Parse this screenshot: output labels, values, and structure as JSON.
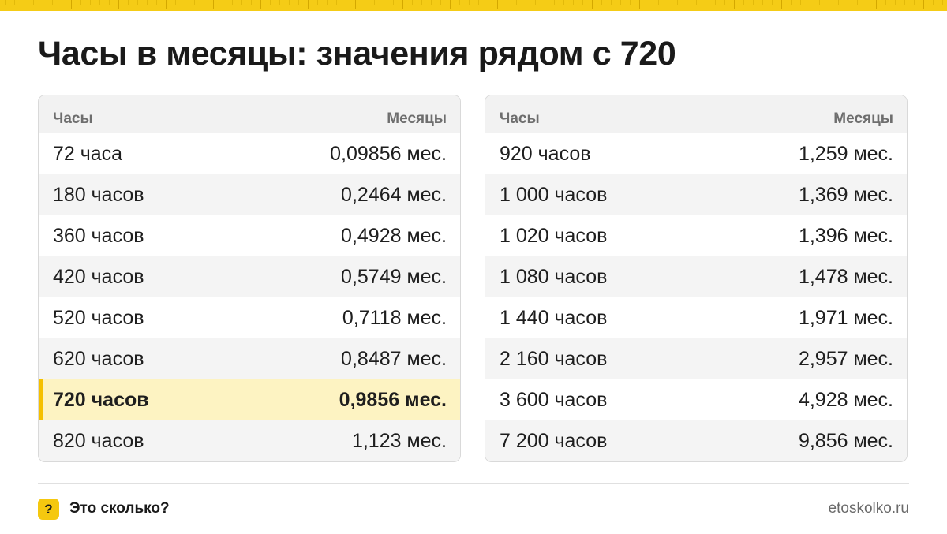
{
  "header": {
    "title": "Часы в месяцы: значения рядом с 720"
  },
  "colors": {
    "accent": "#f5c80f",
    "highlight_row": "#fdf3c2",
    "stripe": "#f4f4f4"
  },
  "tables": [
    {
      "col_hours": "Часы",
      "col_months": "Месяцы",
      "rows": [
        {
          "hours": "72 часа",
          "months": "0,09856 мес."
        },
        {
          "hours": "180 часов",
          "months": "0,2464 мес."
        },
        {
          "hours": "360 часов",
          "months": "0,4928 мес."
        },
        {
          "hours": "420 часов",
          "months": "0,5749 мес."
        },
        {
          "hours": "520 часов",
          "months": "0,7118 мес."
        },
        {
          "hours": "620 часов",
          "months": "0,8487 мес."
        },
        {
          "hours": "720 часов",
          "months": "0,9856 мес.",
          "highlighted": true
        },
        {
          "hours": "820 часов",
          "months": "1,123 мес."
        }
      ]
    },
    {
      "col_hours": "Часы",
      "col_months": "Месяцы",
      "rows": [
        {
          "hours": "920 часов",
          "months": "1,259 мес."
        },
        {
          "hours": "1 000 часов",
          "months": "1,369 мес."
        },
        {
          "hours": "1 020 часов",
          "months": "1,396 мес."
        },
        {
          "hours": "1 080 часов",
          "months": "1,478 мес."
        },
        {
          "hours": "1 440 часов",
          "months": "1,971 мес."
        },
        {
          "hours": "2 160 часов",
          "months": "2,957 мес."
        },
        {
          "hours": "3 600 часов",
          "months": "4,928 мес."
        },
        {
          "hours": "7 200 часов",
          "months": "9,856 мес."
        }
      ]
    }
  ],
  "footer": {
    "badge_icon": "question-icon",
    "badge_glyph": "?",
    "brand": "Это сколько?",
    "site": "etoskolko.ru"
  }
}
